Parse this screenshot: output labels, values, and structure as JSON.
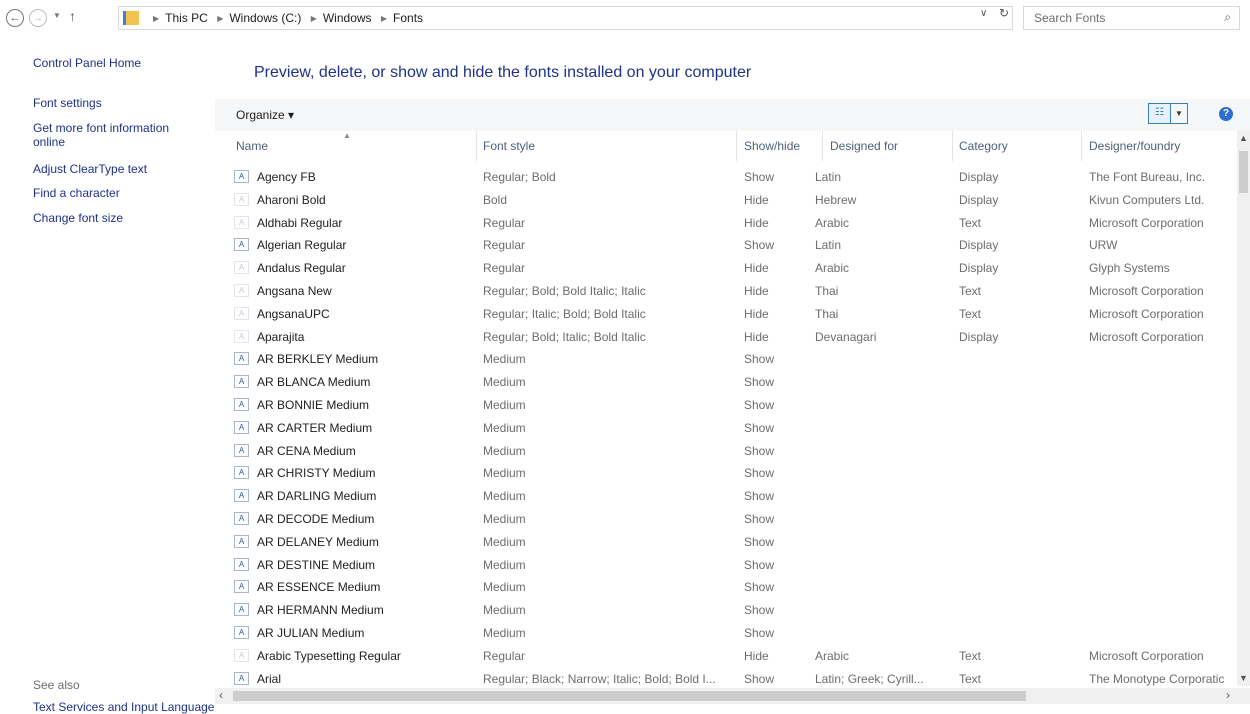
{
  "address": {
    "back_icon": "←",
    "forward_icon": "→",
    "up_icon": "↑",
    "crumbs": [
      "This PC",
      "Windows (C:)",
      "Windows",
      "Fonts"
    ],
    "search_placeholder": "Search Fonts"
  },
  "left_pane": {
    "home": "Control Panel Home",
    "links": [
      "Font settings",
      "Get more font information online",
      "Adjust ClearType text",
      "Find a character",
      "Change font size"
    ],
    "see_also": "See also",
    "see_also_link": "Text Services and Input Language"
  },
  "heading": "Preview, delete, or show and hide the fonts installed on your computer",
  "toolbar": {
    "organize": "Organize ▾"
  },
  "columns": {
    "name": "Name",
    "style": "Font style",
    "showhide": "Show/hide",
    "designed": "Designed for",
    "category": "Category",
    "designer": "Designer/foundry"
  },
  "rows": [
    {
      "name": "Agency FB",
      "style": "Regular; Bold",
      "show": "Show",
      "designed": "Latin",
      "category": "Display",
      "designer": "The Font Bureau, Inc."
    },
    {
      "name": "Aharoni Bold",
      "style": "Bold",
      "show": "Hide",
      "designed": "Hebrew",
      "category": "Display",
      "designer": "Kivun Computers Ltd."
    },
    {
      "name": "Aldhabi Regular",
      "style": "Regular",
      "show": "Hide",
      "designed": "Arabic",
      "category": "Text",
      "designer": "Microsoft Corporation"
    },
    {
      "name": "Algerian Regular",
      "style": "Regular",
      "show": "Show",
      "designed": "Latin",
      "category": "Display",
      "designer": "URW"
    },
    {
      "name": "Andalus Regular",
      "style": "Regular",
      "show": "Hide",
      "designed": "Arabic",
      "category": "Display",
      "designer": "Glyph Systems"
    },
    {
      "name": "Angsana New",
      "style": "Regular; Bold; Bold Italic; Italic",
      "show": "Hide",
      "designed": "Thai",
      "category": "Text",
      "designer": "Microsoft Corporation"
    },
    {
      "name": "AngsanaUPC",
      "style": "Regular; Italic; Bold; Bold Italic",
      "show": "Hide",
      "designed": "Thai",
      "category": "Text",
      "designer": "Microsoft Corporation"
    },
    {
      "name": "Aparajita",
      "style": "Regular; Bold; Italic; Bold Italic",
      "show": "Hide",
      "designed": "Devanagari",
      "category": "Display",
      "designer": "Microsoft Corporation"
    },
    {
      "name": "AR BERKLEY Medium",
      "style": "Medium",
      "show": "Show",
      "designed": "",
      "category": "",
      "designer": ""
    },
    {
      "name": "AR BLANCA Medium",
      "style": "Medium",
      "show": "Show",
      "designed": "",
      "category": "",
      "designer": ""
    },
    {
      "name": "AR BONNIE Medium",
      "style": "Medium",
      "show": "Show",
      "designed": "",
      "category": "",
      "designer": ""
    },
    {
      "name": "AR CARTER Medium",
      "style": "Medium",
      "show": "Show",
      "designed": "",
      "category": "",
      "designer": ""
    },
    {
      "name": "AR CENA Medium",
      "style": "Medium",
      "show": "Show",
      "designed": "",
      "category": "",
      "designer": ""
    },
    {
      "name": "AR CHRISTY Medium",
      "style": "Medium",
      "show": "Show",
      "designed": "",
      "category": "",
      "designer": ""
    },
    {
      "name": "AR DARLING Medium",
      "style": "Medium",
      "show": "Show",
      "designed": "",
      "category": "",
      "designer": ""
    },
    {
      "name": "AR DECODE Medium",
      "style": "Medium",
      "show": "Show",
      "designed": "",
      "category": "",
      "designer": ""
    },
    {
      "name": "AR DELANEY Medium",
      "style": "Medium",
      "show": "Show",
      "designed": "",
      "category": "",
      "designer": ""
    },
    {
      "name": "AR DESTINE Medium",
      "style": "Medium",
      "show": "Show",
      "designed": "",
      "category": "",
      "designer": ""
    },
    {
      "name": "AR ESSENCE Medium",
      "style": "Medium",
      "show": "Show",
      "designed": "",
      "category": "",
      "designer": ""
    },
    {
      "name": "AR HERMANN Medium",
      "style": "Medium",
      "show": "Show",
      "designed": "",
      "category": "",
      "designer": ""
    },
    {
      "name": "AR JULIAN Medium",
      "style": "Medium",
      "show": "Show",
      "designed": "",
      "category": "",
      "designer": ""
    },
    {
      "name": "Arabic Typesetting Regular",
      "style": "Regular",
      "show": "Hide",
      "designed": "Arabic",
      "category": "Text",
      "designer": "Microsoft Corporation"
    },
    {
      "name": "Arial",
      "style": "Regular; Black; Narrow; Italic; Bold; Bold I...",
      "show": "Show",
      "designed": "Latin; Greek; Cyrill...",
      "category": "Text",
      "designer": "The Monotype Corporatic"
    }
  ]
}
